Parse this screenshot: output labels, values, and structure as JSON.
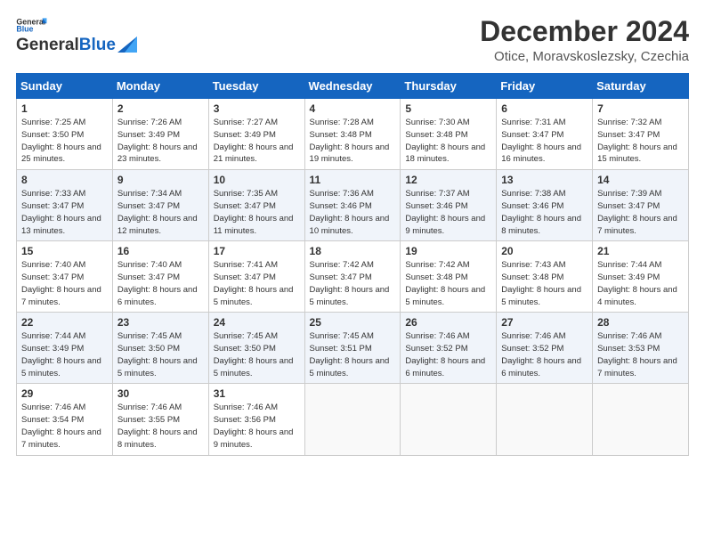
{
  "logo": {
    "general": "General",
    "blue": "Blue"
  },
  "title": "December 2024",
  "location": "Otice, Moravskoslezsky, Czechia",
  "days_of_week": [
    "Sunday",
    "Monday",
    "Tuesday",
    "Wednesday",
    "Thursday",
    "Friday",
    "Saturday"
  ],
  "weeks": [
    [
      {
        "day": "1",
        "sunrise": "Sunrise: 7:25 AM",
        "sunset": "Sunset: 3:50 PM",
        "daylight": "Daylight: 8 hours and 25 minutes."
      },
      {
        "day": "2",
        "sunrise": "Sunrise: 7:26 AM",
        "sunset": "Sunset: 3:49 PM",
        "daylight": "Daylight: 8 hours and 23 minutes."
      },
      {
        "day": "3",
        "sunrise": "Sunrise: 7:27 AM",
        "sunset": "Sunset: 3:49 PM",
        "daylight": "Daylight: 8 hours and 21 minutes."
      },
      {
        "day": "4",
        "sunrise": "Sunrise: 7:28 AM",
        "sunset": "Sunset: 3:48 PM",
        "daylight": "Daylight: 8 hours and 19 minutes."
      },
      {
        "day": "5",
        "sunrise": "Sunrise: 7:30 AM",
        "sunset": "Sunset: 3:48 PM",
        "daylight": "Daylight: 8 hours and 18 minutes."
      },
      {
        "day": "6",
        "sunrise": "Sunrise: 7:31 AM",
        "sunset": "Sunset: 3:47 PM",
        "daylight": "Daylight: 8 hours and 16 minutes."
      },
      {
        "day": "7",
        "sunrise": "Sunrise: 7:32 AM",
        "sunset": "Sunset: 3:47 PM",
        "daylight": "Daylight: 8 hours and 15 minutes."
      }
    ],
    [
      {
        "day": "8",
        "sunrise": "Sunrise: 7:33 AM",
        "sunset": "Sunset: 3:47 PM",
        "daylight": "Daylight: 8 hours and 13 minutes."
      },
      {
        "day": "9",
        "sunrise": "Sunrise: 7:34 AM",
        "sunset": "Sunset: 3:47 PM",
        "daylight": "Daylight: 8 hours and 12 minutes."
      },
      {
        "day": "10",
        "sunrise": "Sunrise: 7:35 AM",
        "sunset": "Sunset: 3:47 PM",
        "daylight": "Daylight: 8 hours and 11 minutes."
      },
      {
        "day": "11",
        "sunrise": "Sunrise: 7:36 AM",
        "sunset": "Sunset: 3:46 PM",
        "daylight": "Daylight: 8 hours and 10 minutes."
      },
      {
        "day": "12",
        "sunrise": "Sunrise: 7:37 AM",
        "sunset": "Sunset: 3:46 PM",
        "daylight": "Daylight: 8 hours and 9 minutes."
      },
      {
        "day": "13",
        "sunrise": "Sunrise: 7:38 AM",
        "sunset": "Sunset: 3:46 PM",
        "daylight": "Daylight: 8 hours and 8 minutes."
      },
      {
        "day": "14",
        "sunrise": "Sunrise: 7:39 AM",
        "sunset": "Sunset: 3:47 PM",
        "daylight": "Daylight: 8 hours and 7 minutes."
      }
    ],
    [
      {
        "day": "15",
        "sunrise": "Sunrise: 7:40 AM",
        "sunset": "Sunset: 3:47 PM",
        "daylight": "Daylight: 8 hours and 7 minutes."
      },
      {
        "day": "16",
        "sunrise": "Sunrise: 7:40 AM",
        "sunset": "Sunset: 3:47 PM",
        "daylight": "Daylight: 8 hours and 6 minutes."
      },
      {
        "day": "17",
        "sunrise": "Sunrise: 7:41 AM",
        "sunset": "Sunset: 3:47 PM",
        "daylight": "Daylight: 8 hours and 5 minutes."
      },
      {
        "day": "18",
        "sunrise": "Sunrise: 7:42 AM",
        "sunset": "Sunset: 3:47 PM",
        "daylight": "Daylight: 8 hours and 5 minutes."
      },
      {
        "day": "19",
        "sunrise": "Sunrise: 7:42 AM",
        "sunset": "Sunset: 3:48 PM",
        "daylight": "Daylight: 8 hours and 5 minutes."
      },
      {
        "day": "20",
        "sunrise": "Sunrise: 7:43 AM",
        "sunset": "Sunset: 3:48 PM",
        "daylight": "Daylight: 8 hours and 5 minutes."
      },
      {
        "day": "21",
        "sunrise": "Sunrise: 7:44 AM",
        "sunset": "Sunset: 3:49 PM",
        "daylight": "Daylight: 8 hours and 4 minutes."
      }
    ],
    [
      {
        "day": "22",
        "sunrise": "Sunrise: 7:44 AM",
        "sunset": "Sunset: 3:49 PM",
        "daylight": "Daylight: 8 hours and 5 minutes."
      },
      {
        "day": "23",
        "sunrise": "Sunrise: 7:45 AM",
        "sunset": "Sunset: 3:50 PM",
        "daylight": "Daylight: 8 hours and 5 minutes."
      },
      {
        "day": "24",
        "sunrise": "Sunrise: 7:45 AM",
        "sunset": "Sunset: 3:50 PM",
        "daylight": "Daylight: 8 hours and 5 minutes."
      },
      {
        "day": "25",
        "sunrise": "Sunrise: 7:45 AM",
        "sunset": "Sunset: 3:51 PM",
        "daylight": "Daylight: 8 hours and 5 minutes."
      },
      {
        "day": "26",
        "sunrise": "Sunrise: 7:46 AM",
        "sunset": "Sunset: 3:52 PM",
        "daylight": "Daylight: 8 hours and 6 minutes."
      },
      {
        "day": "27",
        "sunrise": "Sunrise: 7:46 AM",
        "sunset": "Sunset: 3:52 PM",
        "daylight": "Daylight: 8 hours and 6 minutes."
      },
      {
        "day": "28",
        "sunrise": "Sunrise: 7:46 AM",
        "sunset": "Sunset: 3:53 PM",
        "daylight": "Daylight: 8 hours and 7 minutes."
      }
    ],
    [
      {
        "day": "29",
        "sunrise": "Sunrise: 7:46 AM",
        "sunset": "Sunset: 3:54 PM",
        "daylight": "Daylight: 8 hours and 7 minutes."
      },
      {
        "day": "30",
        "sunrise": "Sunrise: 7:46 AM",
        "sunset": "Sunset: 3:55 PM",
        "daylight": "Daylight: 8 hours and 8 minutes."
      },
      {
        "day": "31",
        "sunrise": "Sunrise: 7:46 AM",
        "sunset": "Sunset: 3:56 PM",
        "daylight": "Daylight: 8 hours and 9 minutes."
      },
      null,
      null,
      null,
      null
    ]
  ]
}
